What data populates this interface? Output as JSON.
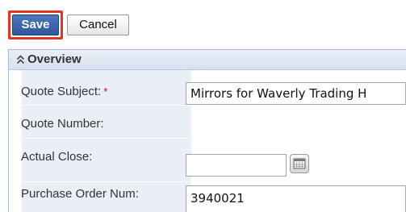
{
  "toolbar": {
    "save_label": "Save",
    "cancel_label": "Cancel"
  },
  "panel": {
    "title": "Overview",
    "collapse_icon": "chevron-up-double-icon"
  },
  "fields": {
    "quote_subject": {
      "label": "Quote Subject:",
      "required_marker": "*",
      "value": "Mirrors for Waverly Trading H"
    },
    "quote_number": {
      "label": "Quote Number:"
    },
    "actual_close": {
      "label": "Actual Close:",
      "value": "",
      "calendar_icon": "calendar-icon"
    },
    "purchase_order_num": {
      "label": "Purchase Order Num:",
      "value": "3940021"
    }
  },
  "colors": {
    "save_button": "#3a64a8",
    "highlight": "#e2351f",
    "panel_header": "#dde5f1",
    "label_column": "#e9eef7",
    "required": "#d40000"
  }
}
